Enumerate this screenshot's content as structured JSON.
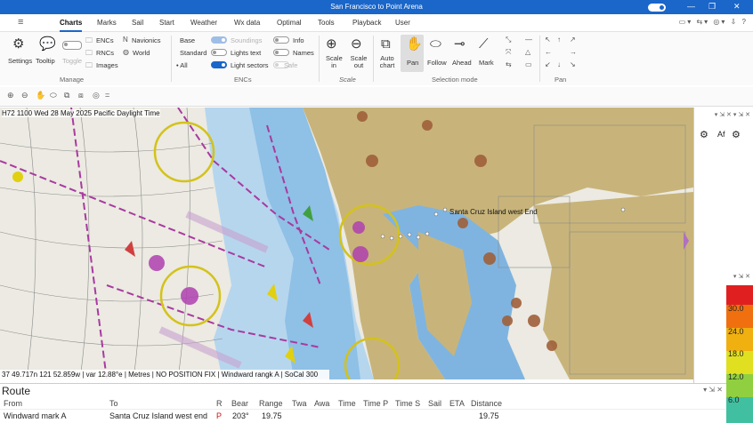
{
  "window": {
    "title": "San Francisco to Point Arena"
  },
  "menu": {
    "items": [
      "Charts",
      "Marks",
      "Sail",
      "Start",
      "Weather",
      "Wx data",
      "Optimal",
      "Tools",
      "Playback",
      "User"
    ],
    "active": "Charts"
  },
  "ribbon": {
    "manage": {
      "settings": "Settings",
      "tooltip": "Tooltip",
      "toggle": "Toggle",
      "encs": "ENCs",
      "rncs": "RNCs",
      "images": "Images",
      "navionics": "Navionics",
      "world": "World",
      "label": "Manage"
    },
    "encs": {
      "base": "Base",
      "standard": "Standard",
      "all": "All",
      "soundings": "Soundings",
      "lights_text": "Lights text",
      "light_sectors": "Light sectors",
      "info": "Info",
      "names": "Names",
      "safe": "Safe",
      "label": "ENCs"
    },
    "scale": {
      "scale_in": "Scale in",
      "scale_out": "Scale out",
      "label": "Scale"
    },
    "selection": {
      "auto_chart": "Auto chart",
      "pan": "Pan",
      "follow": "Follow",
      "ahead": "Ahead",
      "mark": "Mark",
      "label": "Selection mode"
    },
    "pan": {
      "label": "Pan"
    }
  },
  "chart": {
    "header": "H72 1100 Wed 28 May 2025 Pacific Daylight Time",
    "status": "37 49.717n 121 52.859w | var 12.88°e | Metres | NO POSITION FIX | Windward rangk A | SoCal 300",
    "label_overlap": "Santa Cruz Island west End"
  },
  "scale": {
    "labels": [
      "30.0",
      "24.0",
      "18.0",
      "12.0",
      "6.0"
    ]
  },
  "route": {
    "title": "Route",
    "columns": [
      "From",
      "To",
      "R",
      "Bear",
      "Range",
      "Twa",
      "Awa",
      "Time",
      "Time P",
      "Time S",
      "Sail",
      "ETA",
      "Distance"
    ],
    "rows": [
      {
        "from": "Windward mark A",
        "to": "Santa Cruz Island west end",
        "r": "P",
        "bear": "203°",
        "range": "19.75",
        "distance": "19.75"
      }
    ]
  },
  "colors": {
    "accent": "#1a66c9",
    "land": "#c8b47a",
    "water": "#7fb4e0",
    "danger": "#a83aa0",
    "buoy": "#a0603a"
  }
}
